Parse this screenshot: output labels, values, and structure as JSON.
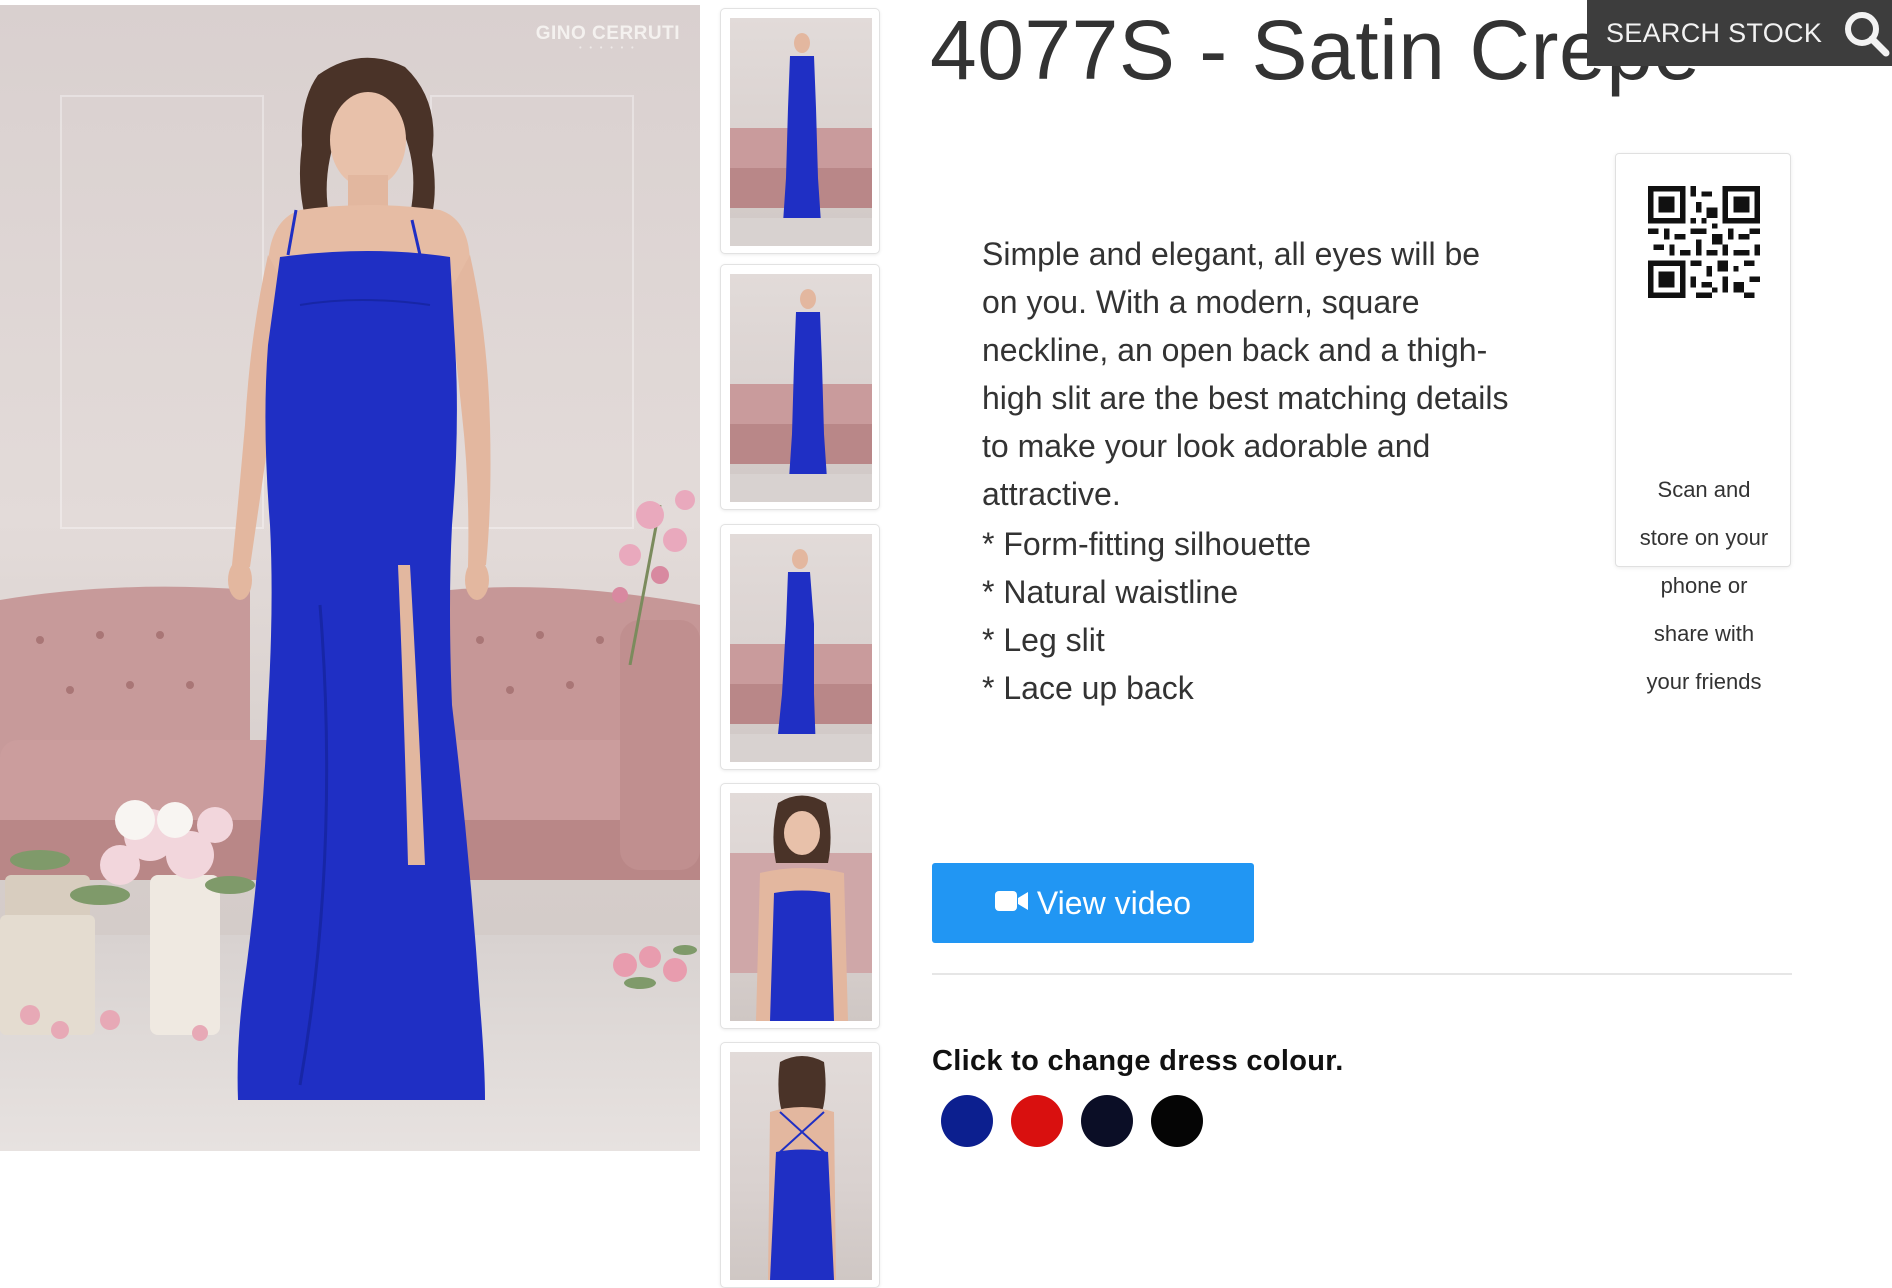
{
  "product": {
    "title": "4077S - Satin Crepe",
    "description": "Simple and elegant, all eyes will be on you. With a modern, square neckline, an open back and a thigh-high slit are the best matching details to make your look adorable and attractive.",
    "features": [
      "* Form-fitting silhouette",
      "* Natural waistline",
      "* Leg slit",
      "* Lace up back"
    ]
  },
  "header": {
    "search_label": "SEARCH STOCK",
    "search_icon": "search-icon"
  },
  "main_image": {
    "brand": "GINO CERRUTI",
    "dress_color": "#1f2fc4"
  },
  "thumbnails": [
    {
      "view": "front"
    },
    {
      "view": "front"
    },
    {
      "view": "side"
    },
    {
      "view": "close-up"
    },
    {
      "view": "back"
    }
  ],
  "qr": {
    "lines": [
      "Scan and",
      "store on your",
      "phone or",
      "share with",
      "your friends"
    ]
  },
  "video": {
    "label": "View video",
    "icon": "video-camera-icon",
    "color": "#2196f3"
  },
  "colours": {
    "title": "Click to change dress colour.",
    "options": [
      {
        "color": "#0c1f8f"
      },
      {
        "color": "#d9100f"
      },
      {
        "color": "#0b0e26"
      },
      {
        "color": "#050505"
      }
    ]
  }
}
